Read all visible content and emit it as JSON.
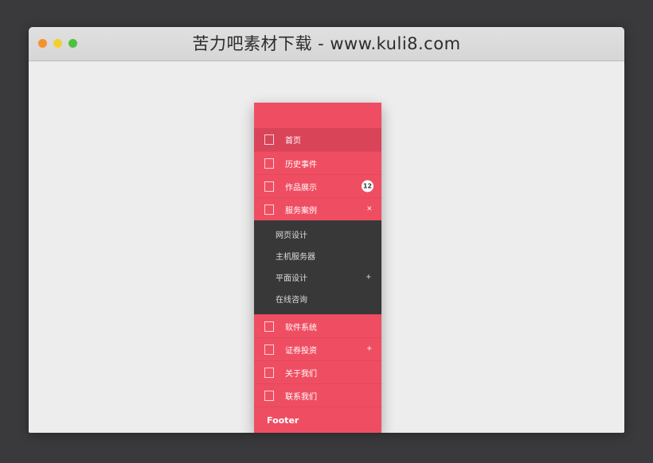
{
  "window": {
    "title": "苦力吧素材下载 - www.kuli8.com",
    "controls": [
      {
        "name": "close",
        "color": "#f6912e"
      },
      {
        "name": "minimize",
        "color": "#f3d02f"
      },
      {
        "name": "maximize",
        "color": "#4cc240"
      }
    ]
  },
  "colors": {
    "accent": "#ef4e62",
    "accent_active": "#d94458",
    "submenu_bg": "#383838",
    "page_bg": "#ededed",
    "titlebar_bg": "#d9d9d9",
    "desktop_bg": "#3a3a3c"
  },
  "menu": {
    "items": [
      {
        "label": "首页",
        "icon": "tofu-box-icon",
        "active": true,
        "right": "",
        "badge": ""
      },
      {
        "label": "历史事件",
        "icon": "tofu-box-icon",
        "active": false,
        "right": "",
        "badge": ""
      },
      {
        "label": "作品展示",
        "icon": "tofu-box-icon",
        "active": false,
        "right": "",
        "badge": "12"
      },
      {
        "label": "服务案例",
        "icon": "tofu-box-icon",
        "active": false,
        "right": "×",
        "badge": ""
      }
    ],
    "submenu": [
      {
        "label": "网页设计",
        "right": ""
      },
      {
        "label": "主机服务器",
        "right": ""
      },
      {
        "label": "平面设计",
        "right": "+"
      },
      {
        "label": "在线咨询",
        "right": ""
      }
    ],
    "items_lower": [
      {
        "label": "软件系统",
        "icon": "tofu-box-icon",
        "active": false,
        "right": "",
        "badge": ""
      },
      {
        "label": "证券投资",
        "icon": "tofu-box-icon",
        "active": false,
        "right": "+",
        "badge": ""
      },
      {
        "label": "关于我们",
        "icon": "tofu-box-icon",
        "active": false,
        "right": "",
        "badge": ""
      },
      {
        "label": "联系我们",
        "icon": "tofu-box-icon",
        "active": false,
        "right": "",
        "badge": ""
      }
    ],
    "footer": {
      "label": "Footer"
    }
  }
}
